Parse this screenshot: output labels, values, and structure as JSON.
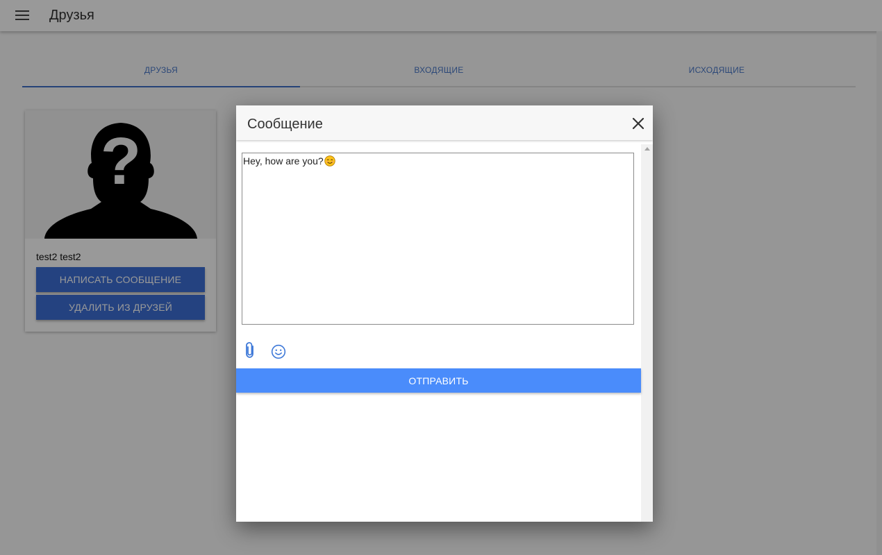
{
  "app_title": "Друзья",
  "tabs": [
    {
      "label": "ДРУЗЬЯ",
      "active": true
    },
    {
      "label": "ВХОДЯЩИЕ",
      "active": false
    },
    {
      "label": "ИСХОДЯЩИЕ",
      "active": false
    }
  ],
  "friend_card": {
    "name": "test2 test2",
    "write_message_label": "НАПИСАТЬ СООБЩЕНИЕ",
    "remove_friend_label": "УДАЛИТЬ ИЗ ДРУЗЕЙ",
    "avatar_icon": "unknown-person-silhouette"
  },
  "dialog": {
    "title": "Сообщение",
    "message_text": "Hey, how are you?",
    "message_emoji": "smiling-face-emoji",
    "send_label": "ОТПРАВИТЬ",
    "icons": {
      "close": "close-icon",
      "attach": "paperclip-icon",
      "emoji": "smiley-icon"
    }
  },
  "colors": {
    "accent": "#3f6fc8",
    "card_button": "#3d6fd6",
    "send_button": "#4a8cfb",
    "overlay": "rgba(0,0,0,0.40)"
  }
}
